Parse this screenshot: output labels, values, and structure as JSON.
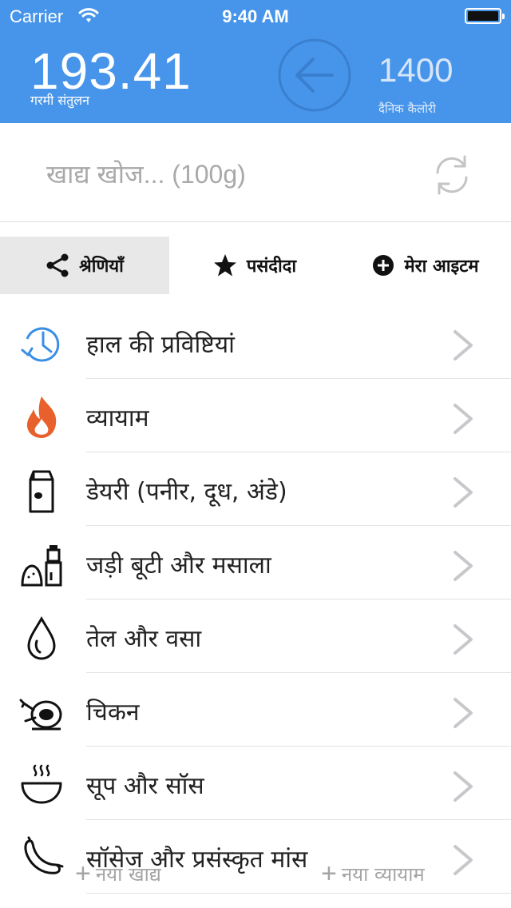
{
  "status_bar": {
    "carrier": "Carrier",
    "time": "9:40 AM"
  },
  "header": {
    "balance_value": "193.41",
    "balance_label": "गरमी संतुलन",
    "daily_value": "1400",
    "daily_label": "दैनिक कैलोरी",
    "accent_color": "#4795ea"
  },
  "search": {
    "placeholder": "खाद्य खोज... (100g)",
    "value": ""
  },
  "tabs": [
    {
      "label": "श्रेणियाँ",
      "icon": "share-icon",
      "active": true
    },
    {
      "label": "पसंदीदा",
      "icon": "star-icon",
      "active": false
    },
    {
      "label": "मेरा आइटम",
      "icon": "plus-circle-icon",
      "active": false
    }
  ],
  "categories": [
    {
      "label": "हाल की प्रविष्टियां",
      "icon": "history-clock-icon"
    },
    {
      "label": "व्यायाम",
      "icon": "flame-icon"
    },
    {
      "label": "डेयरी (पनीर, दूध, अंडे)",
      "icon": "milk-carton-icon"
    },
    {
      "label": "जड़ी बूटी और मसाला",
      "icon": "spice-grinder-icon"
    },
    {
      "label": "तेल और वसा",
      "icon": "oil-drop-icon"
    },
    {
      "label": "चिकन",
      "icon": "roast-chicken-icon"
    },
    {
      "label": "सूप और सॉस",
      "icon": "soup-bowl-icon"
    },
    {
      "label": "सॉसेज और प्रसंस्कृत मांस",
      "icon": "sausage-icon"
    }
  ],
  "bottom_bar": {
    "new_food": "नया खाद्य",
    "new_exercise": "नया व्यायाम",
    "plus_glyph": "+"
  }
}
